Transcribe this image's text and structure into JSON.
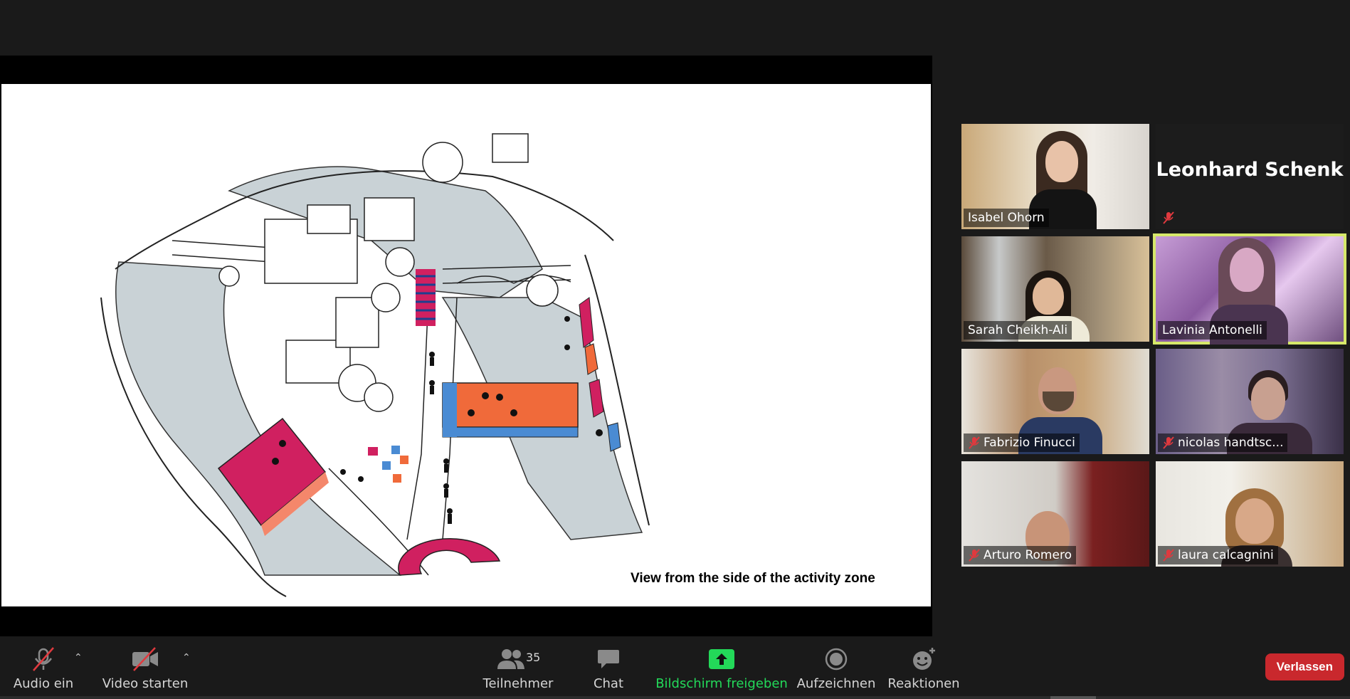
{
  "slide": {
    "caption": "View from the side of the activity zone"
  },
  "participants": [
    {
      "name": "Isabel Ohorn",
      "muted": false,
      "speaking": false,
      "video": true
    },
    {
      "name": "Leonhard Schenk",
      "muted": true,
      "speaking": false,
      "video": false
    },
    {
      "name": "Sarah Cheikh-Ali",
      "muted": false,
      "speaking": false,
      "video": true
    },
    {
      "name": "Lavinia Antonelli",
      "muted": false,
      "speaking": true,
      "video": true
    },
    {
      "name": "Fabrizio Finucci",
      "muted": true,
      "speaking": false,
      "video": true
    },
    {
      "name": "nicolas handtsc...",
      "muted": true,
      "speaking": false,
      "video": true
    },
    {
      "name": "Arturo Romero",
      "muted": true,
      "speaking": false,
      "video": true
    },
    {
      "name": "laura calcagnini",
      "muted": true,
      "speaking": false,
      "video": true
    }
  ],
  "toolbar": {
    "audio_label": "Audio ein",
    "video_label": "Video starten",
    "participants_label": "Teilnehmer",
    "participants_count": "35",
    "chat_label": "Chat",
    "share_label": "Bildschirm freigeben",
    "record_label": "Aufzeichnen",
    "reactions_label": "Reaktionen",
    "leave_label": "Verlassen"
  },
  "colors": {
    "share_green": "#23d959",
    "leave_red": "#c9282d",
    "speaking_highlight": "#d6e86a",
    "mute_red": "#e0393e"
  }
}
